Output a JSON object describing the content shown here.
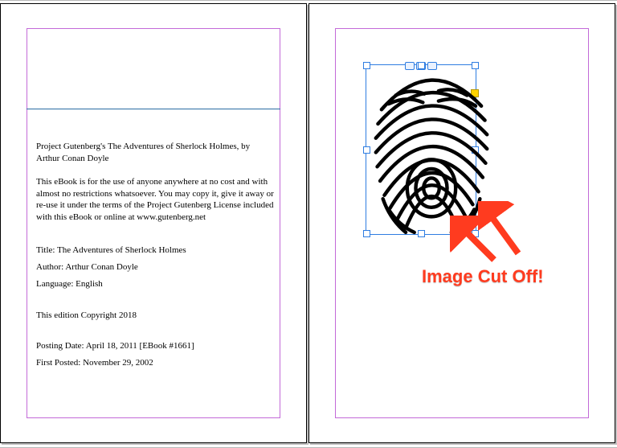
{
  "spread": {
    "left_page": {
      "text": {
        "intro": "Project Gutenberg's The Adventures of Sherlock Holmes, by Arthur Conan Doyle",
        "license": "This eBook is for the use of anyone anywhere at no cost and with almost no restrictions whatsoever.  You may copy it, give it away or re-use it under the terms of the Project Gutenberg License included with this eBook or online at www.gutenberg.net",
        "title_line": "Title: The Adventures of Sherlock Holmes",
        "author_line": "Author: Arthur Conan Doyle",
        "language_line": "Language: English",
        "edition_line": "This edition Copyright 2018",
        "posting_line": "Posting Date: April 18, 2011 [EBook #1661]",
        "first_posted_line": "First Posted: November 29, 2002"
      }
    },
    "right_page": {
      "callout_text": "Image Cut Off!",
      "callout_color": "#ff3b1f",
      "image": {
        "semantic": "fingerprint-illustration",
        "selected": true,
        "frame_cut_off": true
      }
    }
  },
  "guides": {
    "margin_color": "#c36ad8"
  }
}
